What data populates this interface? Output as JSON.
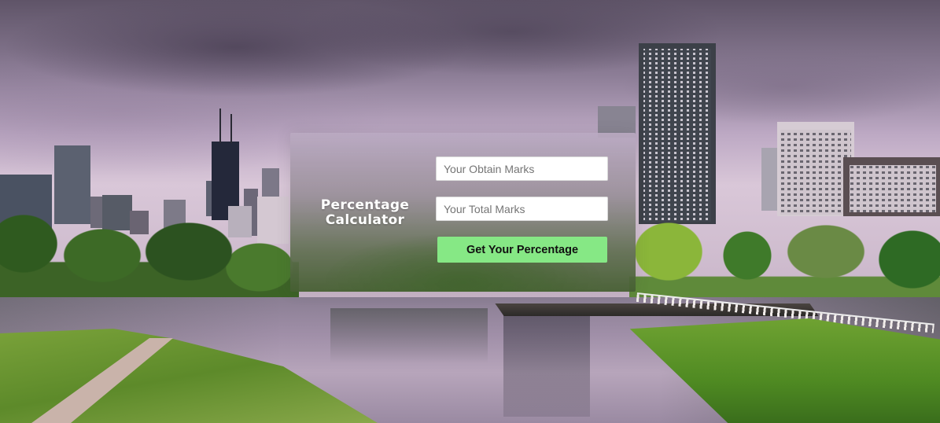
{
  "calculator": {
    "title_line1": "Percentage",
    "title_line2": "Calculator",
    "obtain_marks_placeholder": "Your Obtain Marks",
    "obtain_marks_value": "",
    "total_marks_placeholder": "Your Total Marks",
    "total_marks_value": "",
    "submit_label": "Get Your Percentage"
  },
  "theme": {
    "button_color": "#86e885",
    "title_color": "#ffffff",
    "input_background": "#ffffff"
  },
  "background": {
    "icon": "city-park-skyline-photo"
  }
}
